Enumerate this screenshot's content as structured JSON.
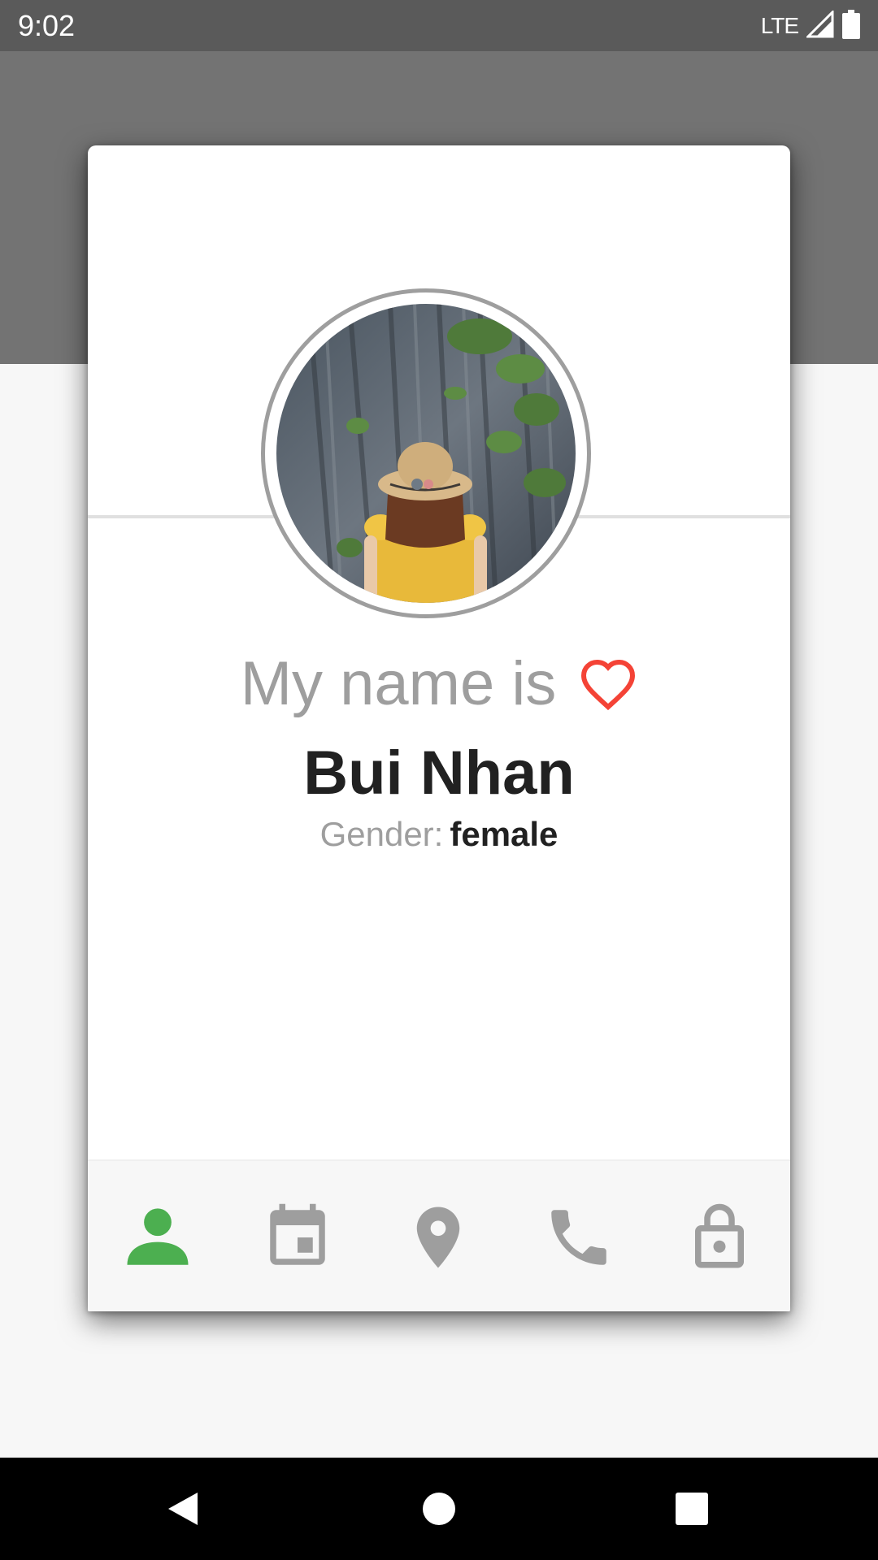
{
  "status_bar": {
    "time": "9:02",
    "network": "LTE",
    "icons": [
      "signal-icon",
      "battery-icon"
    ]
  },
  "card": {
    "title_label": "My name is",
    "name": "Bui Nhan",
    "gender_label": "Gender:",
    "gender_value": "female"
  },
  "tabs": [
    {
      "name": "user-icon",
      "active": true
    },
    {
      "name": "calendar-icon",
      "active": false
    },
    {
      "name": "location-icon",
      "active": false
    },
    {
      "name": "phone-icon",
      "active": false
    },
    {
      "name": "lock-icon",
      "active": false
    }
  ],
  "colors": {
    "active_tab": "#4caf50",
    "inactive_tab": "#9e9e9e",
    "heart": "#f44336",
    "header_band": "#737373"
  },
  "nav_bar": {
    "icons": [
      "back-icon",
      "home-icon",
      "recents-icon"
    ]
  }
}
